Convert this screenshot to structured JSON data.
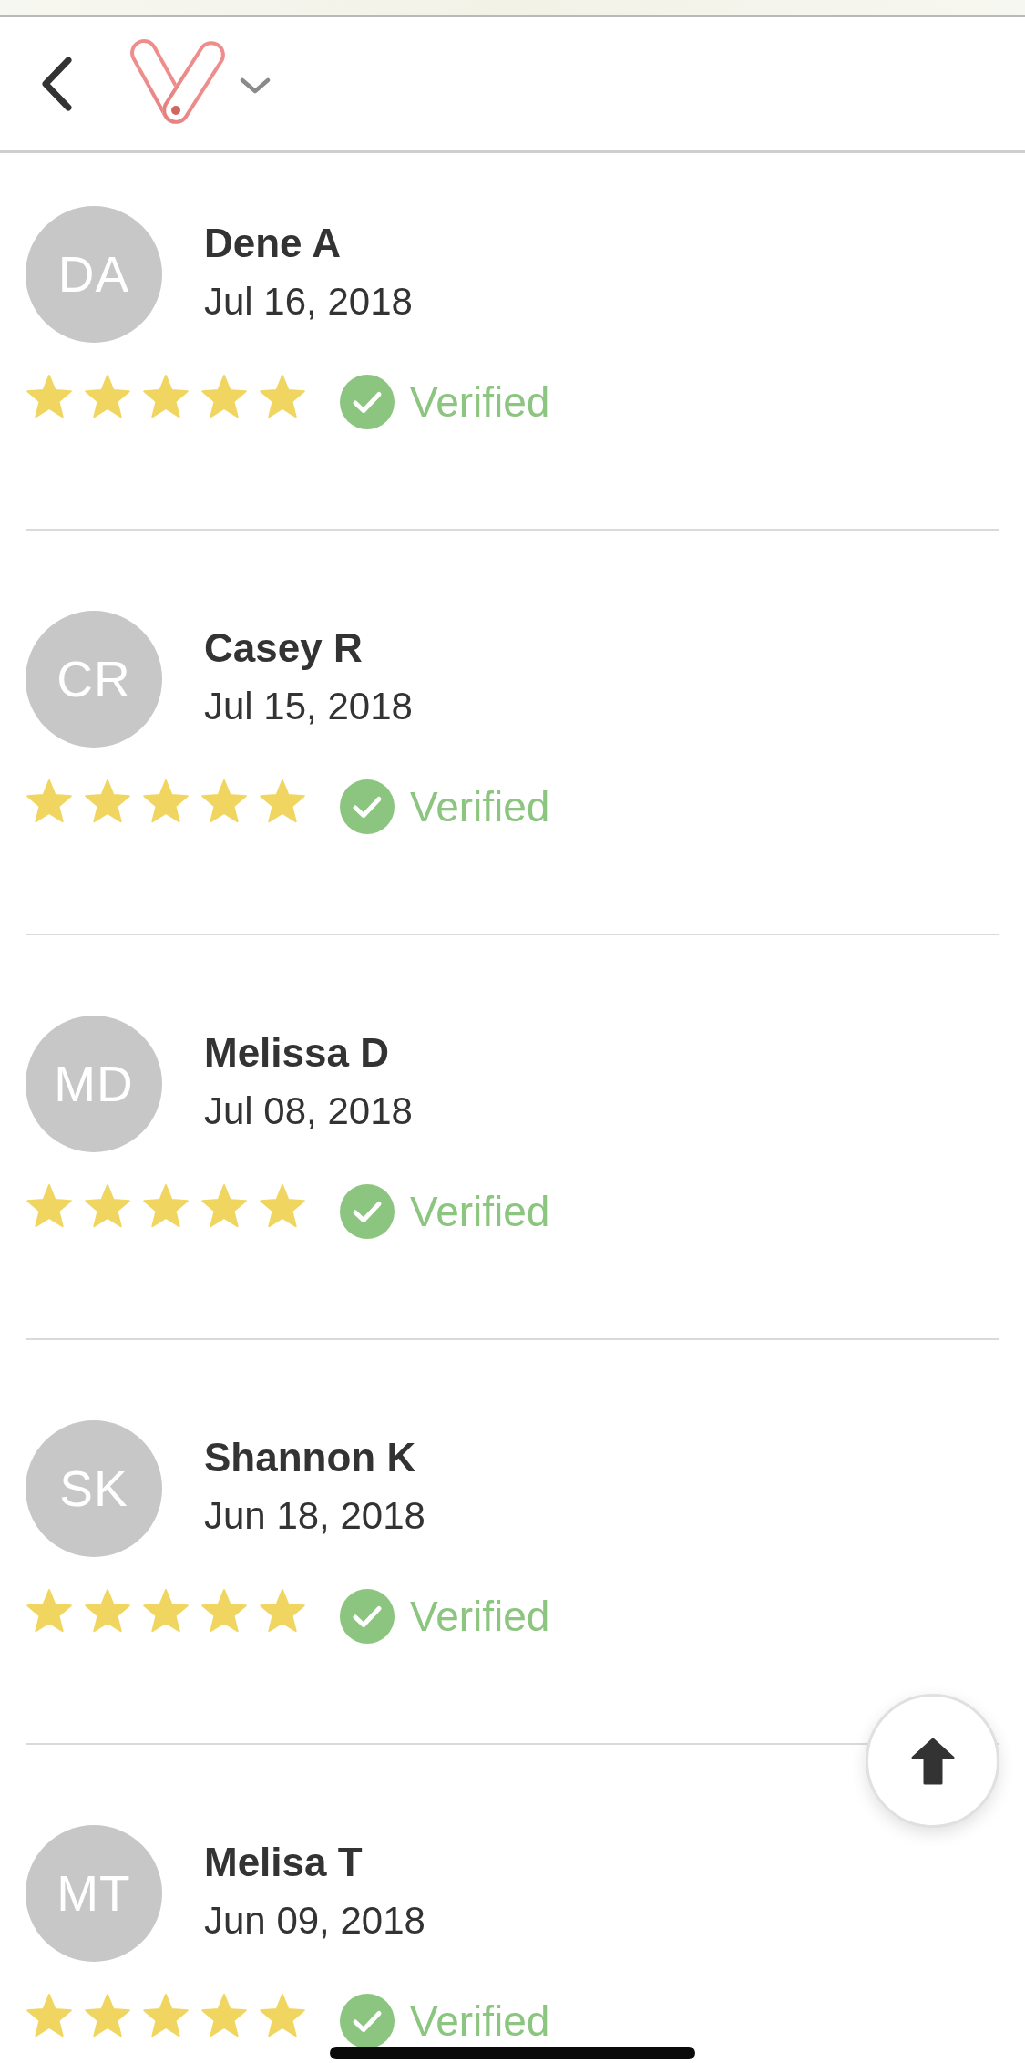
{
  "reviews": [
    {
      "initials": "DA",
      "name": "Dene A",
      "date": "Jul 16, 2018",
      "stars": 5,
      "badge": "Verified"
    },
    {
      "initials": "CR",
      "name": "Casey R",
      "date": "Jul 15, 2018",
      "stars": 5,
      "badge": "Verified"
    },
    {
      "initials": "MD",
      "name": "Melissa D",
      "date": "Jul 08, 2018",
      "stars": 5,
      "badge": "Verified"
    },
    {
      "initials": "SK",
      "name": "Shannon K",
      "date": "Jun 18, 2018",
      "stars": 5,
      "badge": "Verified"
    },
    {
      "initials": "MT",
      "name": "Melisa T",
      "date": "Jun 09, 2018",
      "stars": 5,
      "badge": "Verified"
    }
  ]
}
